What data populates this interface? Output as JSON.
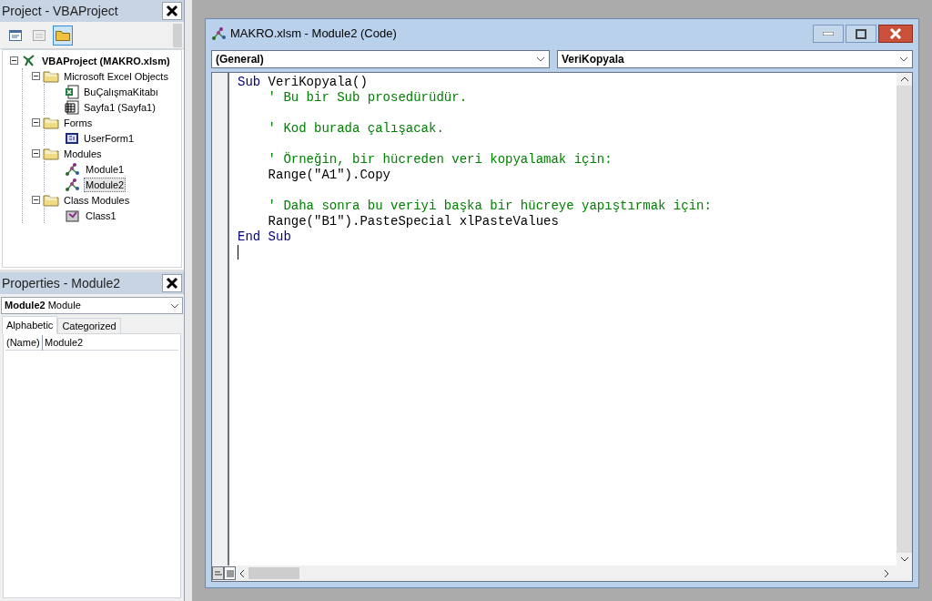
{
  "project_panel": {
    "title": "Project - VBAProject",
    "toolbar": [
      {
        "kind": "view-code",
        "selected": false
      },
      {
        "kind": "view-object",
        "selected": false
      },
      {
        "kind": "toggle-folders",
        "selected": true
      }
    ],
    "tree": [
      {
        "label": "VBAProject (MAKRO.xlsm)",
        "kind": "project",
        "expanded": true,
        "selected": false,
        "children": [
          {
            "label": "Microsoft Excel Objects",
            "kind": "folder",
            "expanded": true,
            "selected": false,
            "children": [
              {
                "label": "BuÇalışmaKitabı",
                "kind": "workbook",
                "selected": false
              },
              {
                "label": "Sayfa1 (Sayfa1)",
                "kind": "sheet",
                "selected": false
              }
            ]
          },
          {
            "label": "Forms",
            "kind": "folder",
            "expanded": true,
            "selected": false,
            "children": [
              {
                "label": "UserForm1",
                "kind": "form",
                "selected": false
              }
            ]
          },
          {
            "label": "Modules",
            "kind": "folder",
            "expanded": true,
            "selected": false,
            "children": [
              {
                "label": "Module1",
                "kind": "module",
                "selected": false
              },
              {
                "label": "Module2",
                "kind": "module",
                "selected": true
              }
            ]
          },
          {
            "label": "Class Modules",
            "kind": "folder",
            "expanded": true,
            "selected": false,
            "children": [
              {
                "label": "Class1",
                "kind": "class",
                "selected": false
              }
            ]
          }
        ]
      }
    ]
  },
  "properties_panel": {
    "title": "Properties - Module2",
    "object_name": "Module2",
    "object_type": "Module",
    "tabs": [
      {
        "label": "Alphabetic",
        "selected": true
      },
      {
        "label": "Categorized",
        "selected": false
      }
    ],
    "rows": [
      {
        "name": "(Name)",
        "value": "Module2"
      }
    ]
  },
  "code_window": {
    "title": "MAKRO.xlsm - Module2 (Code)",
    "object_dropdown": "(General)",
    "procedure_dropdown": "VeriKopyala",
    "lines": [
      {
        "kind": "code",
        "indent": false,
        "segments": [
          {
            "kind": "keyword",
            "text": "Sub"
          },
          {
            "kind": "plain",
            "text": "VeriKopyala()"
          }
        ]
      },
      {
        "kind": "code",
        "indent": true,
        "segments": [
          {
            "kind": "comment",
            "text": "' Bu bir Sub prosedürüdür."
          }
        ]
      },
      {
        "kind": "blank"
      },
      {
        "kind": "code",
        "indent": true,
        "segments": [
          {
            "kind": "comment",
            "text": "' Kod burada çalışacak."
          }
        ]
      },
      {
        "kind": "blank"
      },
      {
        "kind": "code",
        "indent": true,
        "segments": [
          {
            "kind": "comment",
            "text": "' Örneğin, bir hücreden veri kopyalamak için:"
          }
        ]
      },
      {
        "kind": "code",
        "indent": true,
        "segments": [
          {
            "kind": "plain",
            "text": "Range(\"A1\").Copy"
          }
        ]
      },
      {
        "kind": "blank"
      },
      {
        "kind": "code",
        "indent": true,
        "segments": [
          {
            "kind": "comment",
            "text": "' Daha sonra bu veriyi başka bir hücreye yapıştırmak için:"
          }
        ]
      },
      {
        "kind": "code",
        "indent": true,
        "segments": [
          {
            "kind": "plain",
            "text": "Range(\"B1\").PasteSpecial xlPasteValues"
          }
        ]
      },
      {
        "kind": "code",
        "indent": false,
        "segments": [
          {
            "kind": "keyword",
            "text": "End"
          },
          {
            "kind": "keyword",
            "text": "Sub"
          }
        ]
      }
    ],
    "view_buttons": [
      {
        "kind": "procedure",
        "selected": false
      },
      {
        "kind": "module",
        "selected": true
      }
    ]
  }
}
